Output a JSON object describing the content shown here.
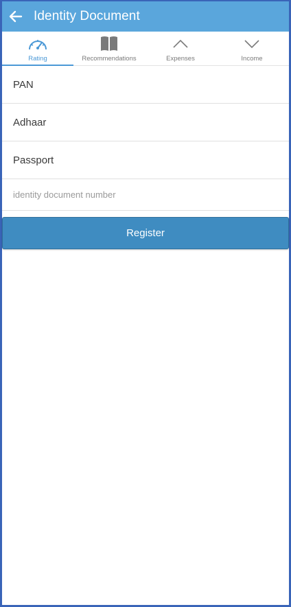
{
  "appbar": {
    "title": "Identity Document",
    "back_icon": "arrow-left-icon"
  },
  "tabs": [
    {
      "label": "Rating",
      "icon": "speedometer-icon",
      "active": true
    },
    {
      "label": "Recommendations",
      "icon": "book-icon",
      "active": false
    },
    {
      "label": "Expenses",
      "icon": "chevron-up-icon",
      "active": false
    },
    {
      "label": "Income",
      "icon": "chevron-down-icon",
      "active": false
    }
  ],
  "documents": [
    {
      "label": "PAN"
    },
    {
      "label": "Adhaar"
    },
    {
      "label": "Passport"
    }
  ],
  "id_input": {
    "value": "",
    "placeholder": "identity document number"
  },
  "register_label": "Register",
  "colors": {
    "appbar": "#5aa6dc",
    "active_tab": "#4a98d6",
    "button": "#3f8cc1",
    "frame": "#3a64b8"
  }
}
